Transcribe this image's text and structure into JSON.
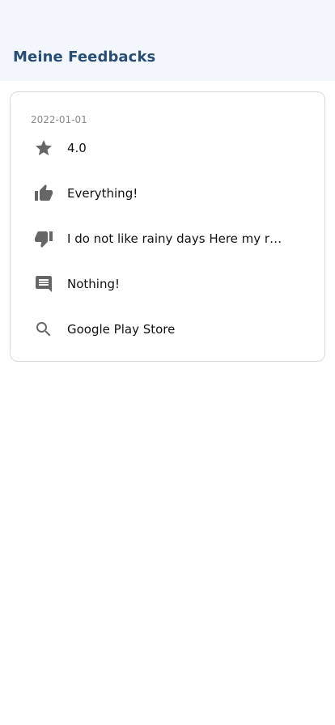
{
  "header": {
    "title": "Meine Feedbacks"
  },
  "feedback": {
    "date": "2022-01-01",
    "rating": "4.0",
    "likes": "Everything!",
    "dislikes": "I do not like rainy days   Here my r…",
    "comment": "Nothing!",
    "source": "Google Play Store"
  },
  "icons": {
    "rating": "star-icon",
    "likes": "thumb-up-icon",
    "dislikes": "thumb-down-icon",
    "comment": "comment-icon",
    "source": "search-icon"
  },
  "colors": {
    "header_bg": "#f2f7fe",
    "title": "#2a4d73",
    "icon": "#666666"
  }
}
